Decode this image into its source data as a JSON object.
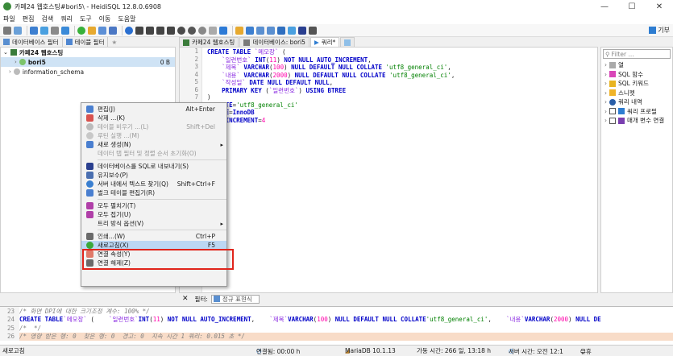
{
  "window": {
    "title": "카페24 웹호스팅#bori5\\ - HeidiSQL 12.8.0.6908",
    "minimize": "—",
    "maximize": "☐",
    "close": "✕"
  },
  "menu": [
    "파일",
    "편집",
    "검색",
    "쿼리",
    "도구",
    "이동",
    "도움말"
  ],
  "toolbar": {
    "donate_label": "기부"
  },
  "left_tabs": [
    {
      "label": "데이터베이스 필터"
    },
    {
      "label": "테이블 필터"
    }
  ],
  "tree": {
    "server": "카페24 웹호스팅",
    "db_selected": "bori5",
    "db_selected_size": "0 B",
    "db_other": "information_schema"
  },
  "right_tabs": [
    {
      "label": "카페24 웹호스팅"
    },
    {
      "label": "데이터베이스: bori5"
    },
    {
      "label": "쿼리*"
    }
  ],
  "editor": {
    "line_numbers": [
      "1",
      "2",
      "3",
      "4",
      "5",
      "6",
      "7",
      "8",
      "9",
      "10",
      "11"
    ]
  },
  "filter": {
    "label": "필터:",
    "placeholder": "정규 표현식"
  },
  "right_panel": {
    "search_placeholder": "Filter ...",
    "items": [
      "열",
      "SQL 함수",
      "SQL 키워드",
      "스니펫",
      "쿼리 내역",
      "쿼리 프로필",
      "매개 변수 연결"
    ]
  },
  "context_menu": {
    "items": [
      {
        "label": "편집(J)",
        "shortcut": "Alt+Enter"
      },
      {
        "label": "삭제 ...(K)",
        "shortcut": ""
      },
      {
        "label": "테이블 비우기 ...(L)",
        "shortcut": "Shift+Del"
      },
      {
        "label": "루틴 실행 ...(M)",
        "shortcut": ""
      },
      {
        "label": "새로 생성(N)",
        "shortcut": ""
      },
      {
        "label": "데이터 탭 필터 및 정렬 순서 초기화(O)",
        "shortcut": ""
      },
      {
        "label": "데이터베이스를 SQL로 내보내기(S)",
        "shortcut": ""
      },
      {
        "label": "유지보수(P)",
        "shortcut": ""
      },
      {
        "label": "서버 내에서 텍스트 찾기(Q)",
        "shortcut": "Shift+Ctrl+F"
      },
      {
        "label": "벌크 테이블 편집기(R)",
        "shortcut": ""
      },
      {
        "label": "모두 펼치기(T)",
        "shortcut": ""
      },
      {
        "label": "모두 접기(U)",
        "shortcut": ""
      },
      {
        "label": "트리 방식 옵션(V)",
        "shortcut": ""
      },
      {
        "label": "인쇄...(W)",
        "shortcut": "Ctrl+P"
      },
      {
        "label": "새로고침(X)",
        "shortcut": "F5"
      },
      {
        "label": "연결 속성(Y)",
        "shortcut": ""
      },
      {
        "label": "연결 해제(Z)",
        "shortcut": ""
      }
    ]
  },
  "log": {
    "lines": [
      "23",
      "24",
      "25",
      "26"
    ]
  },
  "status": {
    "left": "새로고침",
    "connected": "연결됨: 00:00 h",
    "server": "MariaDB 10.1.13",
    "uptime": "가동 시간: 266 일, 13:18 h",
    "server_time": "서버 시간: 오전 12:1",
    "idle": "유휴"
  },
  "colors": {
    "accent": "#2e7dd1",
    "highlight": "#bcd7f3",
    "redbox": "#e0241b",
    "log_highlight": "#f8dcc8"
  }
}
